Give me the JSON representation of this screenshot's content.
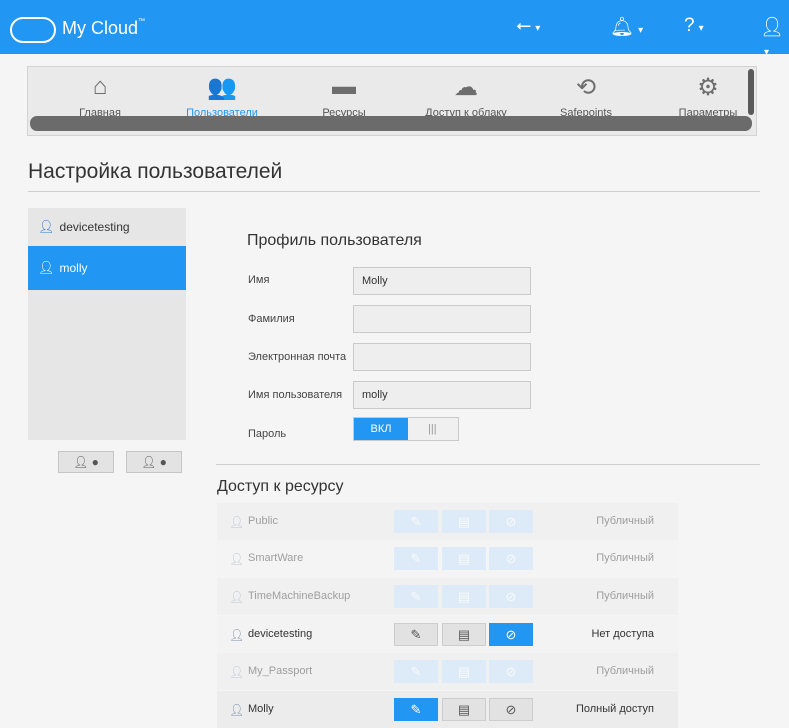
{
  "app": {
    "title": "My Cloud",
    "tm": "™"
  },
  "topbar": {
    "usb_icon": "usb-icon",
    "bell_icon": "bell-icon",
    "help_icon": "help-icon",
    "user_icon": "user-icon",
    "caret": "▾"
  },
  "nav": {
    "items": [
      {
        "label": "Главная",
        "icon": "home-icon",
        "glyph": "⌂"
      },
      {
        "label": "Пользователи",
        "icon": "users-icon",
        "glyph": "👥",
        "active": true
      },
      {
        "label": "Ресурсы",
        "icon": "folder-icon",
        "glyph": "▬"
      },
      {
        "label": "Доступ к облаку",
        "icon": "cloud-device-icon",
        "glyph": "☁"
      },
      {
        "label": "Safepoints",
        "icon": "safepoint-icon",
        "glyph": "⟲"
      },
      {
        "label": "Параметры",
        "icon": "gear-icon",
        "glyph": "⚙"
      }
    ]
  },
  "page": {
    "title": "Настройка пользователей"
  },
  "users": {
    "items": [
      {
        "name": "devicetesting",
        "selected": false
      },
      {
        "name": "molly",
        "selected": true
      }
    ],
    "add_icon": "add-user-icon",
    "remove_icon": "remove-user-icon"
  },
  "profile": {
    "title": "Профиль пользователя",
    "first_name_label": "Имя",
    "first_name_value": "Molly",
    "last_name_label": "Фамилия",
    "last_name_value": "",
    "email_label": "Электронная почта",
    "email_value": "",
    "username_label": "Имя пользователя",
    "username_value": "molly",
    "password_label": "Пароль",
    "password_toggle_on": "ВКЛ",
    "password_toggle_off": "|||"
  },
  "access": {
    "title": "Доступ к ресурсу",
    "rows": [
      {
        "name": "Public",
        "status": "Публичный",
        "dim": true,
        "level": "public"
      },
      {
        "name": "SmartWare",
        "status": "Публичный",
        "dim": true,
        "level": "public"
      },
      {
        "name": "TimeMachineBackup",
        "status": "Публичный",
        "dim": true,
        "level": "public"
      },
      {
        "name": "devicetesting",
        "status": "Нет доступа",
        "dim": false,
        "level": "none"
      },
      {
        "name": "My_Passport",
        "status": "Публичный",
        "dim": true,
        "level": "public"
      },
      {
        "name": "Molly",
        "status": "Полный доступ",
        "dim": false,
        "level": "full"
      }
    ]
  },
  "colors": {
    "accent": "#2196f3"
  }
}
